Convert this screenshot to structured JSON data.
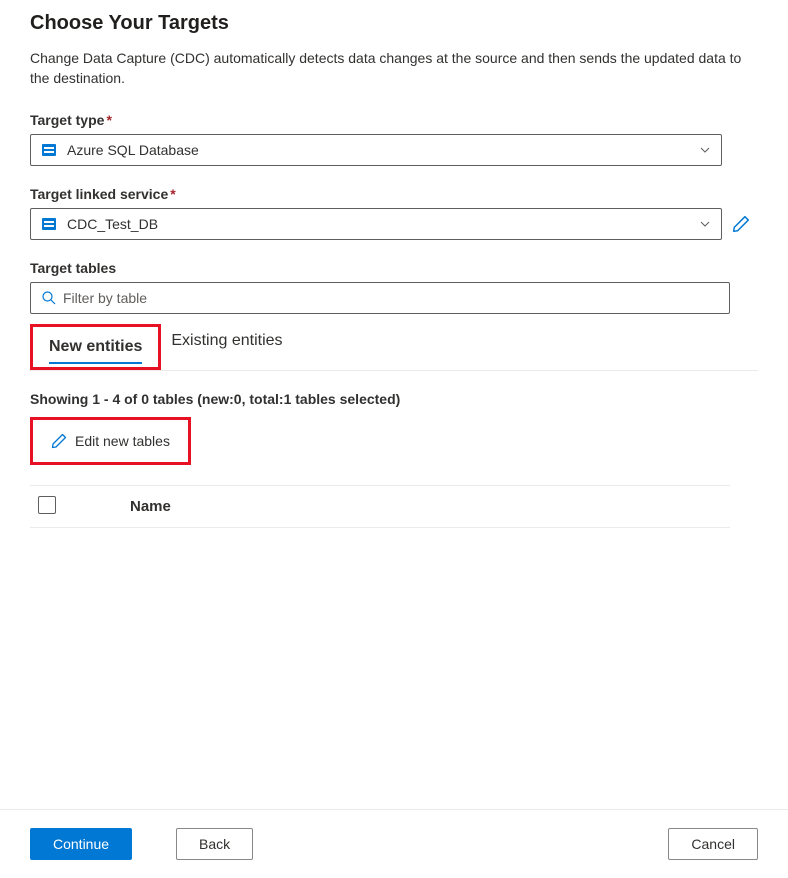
{
  "header": {
    "title": "Choose Your Targets",
    "description": "Change Data Capture (CDC) automatically detects data changes at the source and then sends the updated data to the destination."
  },
  "targetType": {
    "label": "Target type",
    "value": "Azure SQL Database"
  },
  "targetLinkedService": {
    "label": "Target linked service",
    "value": "CDC_Test_DB"
  },
  "targetTables": {
    "label": "Target tables",
    "placeholder": "Filter by table"
  },
  "tabs": {
    "new": "New entities",
    "existing": "Existing entities"
  },
  "showing": "Showing 1 - 4 of 0 tables (new:0, total:1 tables selected)",
  "editNewTables": "Edit new tables",
  "table": {
    "nameHeader": "Name"
  },
  "footer": {
    "continue": "Continue",
    "back": "Back",
    "cancel": "Cancel"
  }
}
